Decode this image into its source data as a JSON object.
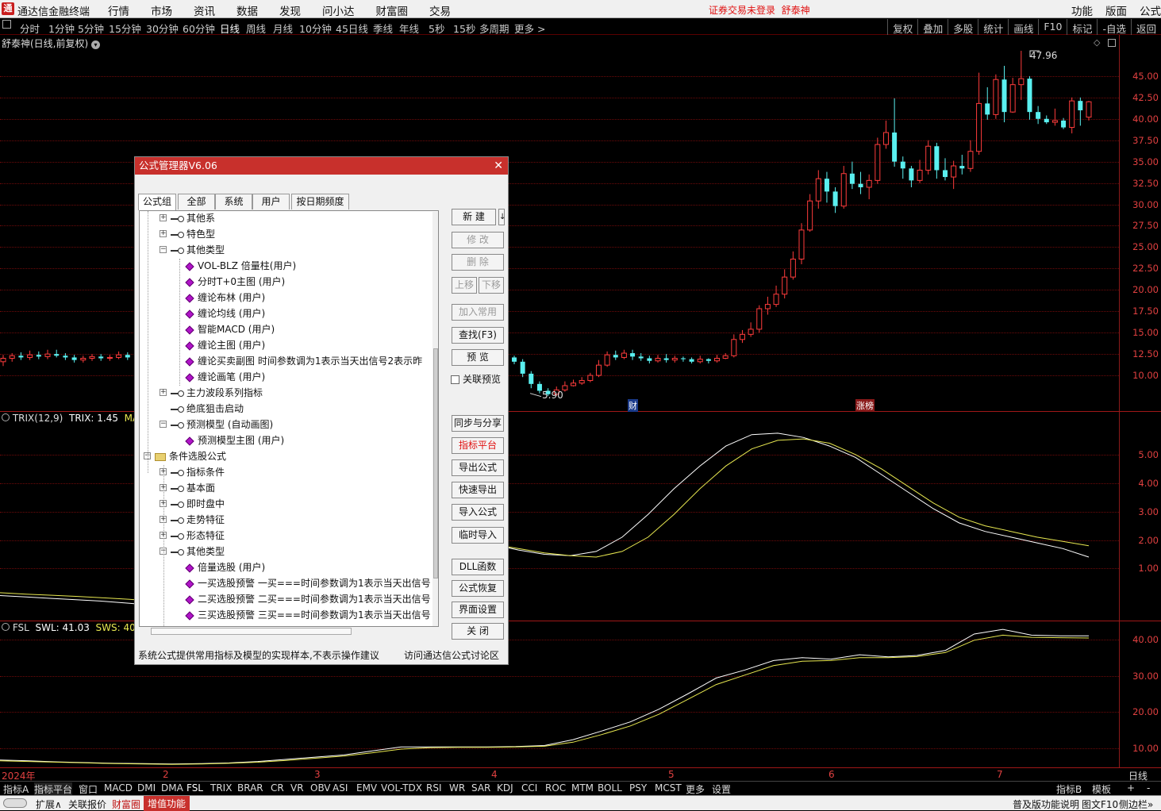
{
  "app": {
    "title": "通达信金融终端",
    "logo": "通"
  },
  "menu": [
    "行情",
    "市场",
    "资讯",
    "数据",
    "发现",
    "问小达",
    "财富圈",
    "交易"
  ],
  "login_status": "证券交易未登录",
  "stock_name": "舒泰神",
  "right_menu": [
    "功能",
    "版面",
    "公式"
  ],
  "periods": [
    "分时",
    "1分钟",
    "5分钟",
    "15分钟",
    "30分钟",
    "60分钟",
    "日线",
    "周线",
    "月线",
    "10分钟",
    "45日线",
    "季线",
    "年线",
    "5秒",
    "15秒",
    "多周期",
    "更多 >"
  ],
  "active_period": "日线",
  "right_tools": [
    "复权",
    "叠加",
    "多股",
    "统计",
    "画线",
    "F10",
    "标记",
    "-自选",
    "返回"
  ],
  "chart_title": "舒泰神(日线,前复权)",
  "price_axis": [
    "45.00",
    "42.50",
    "40.00",
    "37.50",
    "35.00",
    "32.50",
    "30.00",
    "27.50",
    "25.00",
    "22.50",
    "20.00",
    "17.50",
    "15.00",
    "12.50",
    "10.00"
  ],
  "high_label": "47.96",
  "low_label": "5.90",
  "event_tags": [
    "财",
    "涨榜"
  ],
  "trix": {
    "title": "TRIX(12,9)",
    "trix_label": "TRIX: 1.45",
    "matr_label": "MATR",
    "axis": [
      "5.00",
      "4.00",
      "3.00",
      "2.00",
      "1.00"
    ]
  },
  "fsl": {
    "title": "FSL",
    "swl_label": "SWL: 41.03",
    "sws_label": "SWS: 40.4",
    "axis": [
      "40.00",
      "30.00",
      "20.00",
      "10.00"
    ]
  },
  "x_axis": [
    "2024年",
    "2",
    "3",
    "4",
    "5",
    "6",
    "7"
  ],
  "x_axis_right": "日线",
  "indicator_tabs": [
    "指标A",
    "指标平台",
    "窗口",
    "MACD",
    "DMI",
    "DMA",
    "FSL",
    "TRIX",
    "BRAR",
    "CR",
    "VR",
    "OBV",
    "ASI",
    "EMV",
    "VOL-TDX",
    "RSI",
    "WR",
    "SAR",
    "KDJ",
    "CCI",
    "ROC",
    "MTM",
    "BOLL",
    "PSY",
    "MCST",
    "更多",
    "设置"
  ],
  "indicator_tabs_right": [
    "指标B",
    "模板",
    "+",
    "-"
  ],
  "statusbar": {
    "items": [
      "扩展∧",
      "关联报价",
      "财富圈",
      "增值功能"
    ],
    "right": [
      "普及版功能说明",
      "图文F10",
      "侧边栏»"
    ]
  },
  "dialog": {
    "title": "公式管理器V6.06",
    "tabs": [
      "公式组",
      "全部",
      "系统",
      "用户",
      "按日期频度"
    ],
    "tree": [
      {
        "level": 1,
        "type": "key",
        "pm": "+",
        "label": "其他系"
      },
      {
        "level": 1,
        "type": "key",
        "pm": "+",
        "label": "特色型"
      },
      {
        "level": 1,
        "type": "key",
        "pm": "-",
        "label": "其他类型"
      },
      {
        "level": 2,
        "type": "diam",
        "label": "VOL-BLZ  倍量柱(用户)"
      },
      {
        "level": 2,
        "type": "diam",
        "label": "分时T+0主图  (用户)"
      },
      {
        "level": 2,
        "type": "diam",
        "label": "缠论布林  (用户)"
      },
      {
        "level": 2,
        "type": "diam",
        "label": "缠论均线  (用户)"
      },
      {
        "level": 2,
        "type": "diam",
        "label": "智能MACD  (用户)"
      },
      {
        "level": 2,
        "type": "diam",
        "label": "缠论主图  (用户)"
      },
      {
        "level": 2,
        "type": "diam",
        "label": "缠论买卖副图  时间参数调为1表示当天出信号2表示昨"
      },
      {
        "level": 2,
        "type": "diam",
        "label": "缠论画笔  (用户)"
      },
      {
        "level": 1,
        "type": "key",
        "pm": "+",
        "label": "主力波段系列指标"
      },
      {
        "level": 1,
        "type": "key",
        "pm": "",
        "label": "绝底狙击启动"
      },
      {
        "level": 1,
        "type": "key",
        "pm": "-",
        "label": "预测模型  (自动画图)"
      },
      {
        "level": 2,
        "type": "diam",
        "label": "预测模型主图  (用户)"
      },
      {
        "level": 0,
        "type": "folder",
        "pm": "-",
        "label": "条件选股公式"
      },
      {
        "level": 1,
        "type": "key",
        "pm": "+",
        "label": "指标条件"
      },
      {
        "level": 1,
        "type": "key",
        "pm": "+",
        "label": "基本面"
      },
      {
        "level": 1,
        "type": "key",
        "pm": "+",
        "label": "即时盘中"
      },
      {
        "level": 1,
        "type": "key",
        "pm": "+",
        "label": "走势特征"
      },
      {
        "level": 1,
        "type": "key",
        "pm": "+",
        "label": "形态特征"
      },
      {
        "level": 1,
        "type": "key",
        "pm": "-",
        "label": "其他类型"
      },
      {
        "level": 2,
        "type": "diam",
        "label": "倍量选股  (用户)"
      },
      {
        "level": 2,
        "type": "diam",
        "label": "一买选股预警  一买===时间参数调为1表示当天出信号"
      },
      {
        "level": 2,
        "type": "diam",
        "label": "二买选股预警  二买===时间参数调为1表示当天出信号"
      },
      {
        "level": 2,
        "type": "diam",
        "label": "三买选股预警  三买===时间参数调为1表示当天出信号"
      }
    ],
    "buttons": [
      {
        "label": "新  建",
        "state": "normal"
      },
      {
        "label": "修  改",
        "state": "disabled"
      },
      {
        "label": "删  除",
        "state": "disabled"
      },
      {
        "label": "上移",
        "state": "disabled"
      },
      {
        "label": "下移",
        "state": "disabled"
      },
      {
        "label": "加入常用",
        "state": "disabled"
      },
      {
        "label": "查找(F3)",
        "state": "normal"
      },
      {
        "label": "预  览",
        "state": "normal"
      },
      {
        "label": "同步与分享",
        "state": "normal"
      },
      {
        "label": "指标平台",
        "state": "red"
      },
      {
        "label": "导出公式",
        "state": "normal"
      },
      {
        "label": "快速导出",
        "state": "normal"
      },
      {
        "label": "导入公式",
        "state": "normal"
      },
      {
        "label": "临时导入",
        "state": "normal"
      },
      {
        "label": "DLL函数",
        "state": "normal"
      },
      {
        "label": "公式恢复",
        "state": "normal"
      },
      {
        "label": "界面设置",
        "state": "normal"
      },
      {
        "label": "关  闭",
        "state": "normal"
      }
    ],
    "checkbox_label": "关联预览",
    "footer_left": "系统公式提供常用指标及模型的实现样本,不表示操作建议",
    "footer_right": "访问通达信公式讨论区"
  },
  "colors": {
    "up": "#ff3c3c",
    "down": "#5af0f0",
    "line1": "#ffffff",
    "line2": "#e8e850",
    "axis": "#e04040"
  },
  "chart_data": {
    "type": "candlestick",
    "price_range": [
      7.5,
      47.96
    ],
    "candles": [
      [
        11.6,
        12.0,
        12.4,
        11.1
      ],
      [
        12.0,
        12.3,
        12.6,
        11.6
      ],
      [
        12.3,
        12.1,
        12.7,
        11.8
      ],
      [
        12.1,
        12.4,
        12.9,
        11.8
      ],
      [
        12.4,
        12.2,
        12.8,
        11.9
      ],
      [
        12.2,
        12.5,
        13.0,
        11.9
      ],
      [
        12.5,
        12.3,
        13.0,
        12.1
      ],
      [
        12.3,
        12.1,
        12.6,
        11.8
      ],
      [
        12.1,
        11.8,
        12.4,
        11.5
      ],
      [
        11.8,
        12.0,
        12.3,
        11.5
      ],
      [
        12.0,
        12.2,
        12.5,
        11.7
      ],
      [
        12.2,
        12.0,
        12.5,
        11.7
      ],
      [
        12.0,
        12.1,
        12.4,
        11.7
      ],
      [
        12.1,
        12.4,
        12.8,
        11.9
      ],
      [
        12.4,
        12.1,
        12.7,
        11.8
      ],
      [
        12.1,
        11.6,
        12.3,
        11.3
      ],
      [
        11.6,
        10.2,
        11.9,
        9.8
      ],
      [
        10.2,
        9.0,
        10.5,
        8.5
      ],
      [
        9.0,
        8.2,
        9.3,
        7.9
      ],
      [
        8.2,
        7.8,
        8.5,
        7.6
      ],
      [
        7.8,
        8.3,
        8.7,
        7.6
      ],
      [
        8.3,
        8.8,
        9.3,
        8.1
      ],
      [
        8.8,
        9.1,
        9.5,
        8.7
      ],
      [
        9.1,
        9.4,
        9.8,
        8.9
      ],
      [
        9.4,
        10.0,
        10.3,
        9.2
      ],
      [
        10.0,
        11.2,
        11.8,
        9.8
      ],
      [
        11.2,
        12.4,
        12.8,
        11.0
      ],
      [
        12.4,
        12.1,
        12.9,
        11.8
      ],
      [
        12.1,
        12.6,
        13.0,
        11.9
      ],
      [
        12.6,
        12.2,
        13.0,
        11.8
      ],
      [
        12.2,
        12.0,
        12.6,
        11.7
      ],
      [
        12.0,
        11.7,
        12.3,
        11.4
      ],
      [
        11.7,
        12.0,
        12.4,
        11.5
      ],
      [
        12.0,
        11.8,
        12.5,
        11.5
      ],
      [
        11.8,
        12.0,
        12.3,
        11.5
      ],
      [
        12.0,
        11.9,
        12.2,
        11.6
      ],
      [
        11.9,
        11.6,
        12.1,
        11.4
      ],
      [
        11.6,
        11.9,
        12.3,
        11.4
      ],
      [
        11.9,
        11.7,
        12.0,
        11.4
      ],
      [
        11.7,
        12.0,
        12.4,
        11.5
      ],
      [
        12.0,
        12.3,
        12.6,
        11.9
      ],
      [
        12.3,
        14.2,
        14.8,
        12.1
      ],
      [
        14.2,
        14.8,
        15.3,
        13.8
      ],
      [
        14.8,
        15.4,
        16.2,
        14.5
      ],
      [
        15.4,
        17.8,
        18.2,
        15.0
      ],
      [
        17.8,
        18.3,
        19.2,
        17.1
      ],
      [
        18.3,
        19.5,
        20.5,
        18.0
      ],
      [
        19.5,
        21.5,
        22.4,
        19.0
      ],
      [
        21.5,
        23.6,
        24.5,
        21.2
      ],
      [
        23.6,
        27.0,
        27.8,
        23.0
      ],
      [
        27.0,
        30.4,
        31.2,
        26.8
      ],
      [
        30.4,
        33.0,
        34.0,
        29.5
      ],
      [
        33.0,
        31.5,
        33.8,
        30.2
      ],
      [
        31.5,
        29.8,
        32.0,
        29.0
      ],
      [
        29.8,
        33.6,
        34.5,
        29.5
      ],
      [
        33.6,
        32.4,
        35.0,
        31.8
      ],
      [
        32.4,
        32.0,
        33.8,
        31.2
      ],
      [
        32.0,
        32.8,
        33.5,
        30.6
      ],
      [
        32.8,
        37.0,
        37.8,
        32.4
      ],
      [
        37.0,
        38.4,
        39.8,
        36.5
      ],
      [
        38.4,
        35.0,
        42.4,
        34.4
      ],
      [
        35.0,
        34.2,
        35.6,
        33.0
      ],
      [
        34.2,
        32.8,
        34.5,
        32.0
      ],
      [
        32.8,
        34.0,
        35.2,
        32.5
      ],
      [
        34.0,
        36.8,
        37.5,
        33.5
      ],
      [
        36.8,
        34.0,
        37.2,
        33.0
      ],
      [
        34.0,
        33.2,
        35.4,
        32.8
      ],
      [
        33.2,
        34.5,
        35.1,
        31.8
      ],
      [
        34.5,
        34.2,
        35.8,
        33.5
      ],
      [
        34.2,
        36.2,
        37.5,
        33.8
      ],
      [
        36.2,
        41.8,
        45.4,
        35.8
      ],
      [
        41.8,
        40.5,
        43.7,
        39.9
      ],
      [
        40.5,
        44.6,
        45.2,
        40.0
      ],
      [
        44.6,
        40.8,
        46.2,
        39.6
      ],
      [
        40.8,
        44.0,
        44.8,
        40.7
      ],
      [
        44.0,
        44.7,
        47.96,
        42.2
      ],
      [
        44.7,
        40.8,
        45.0,
        39.9
      ],
      [
        40.8,
        40.0,
        41.5,
        39.4
      ],
      [
        40.0,
        39.6,
        40.4,
        39.4
      ],
      [
        39.6,
        39.8,
        41.2,
        39.2
      ],
      [
        39.8,
        39.0,
        40.1,
        38.8
      ],
      [
        39.0,
        42.1,
        42.5,
        38.3
      ],
      [
        42.1,
        41.0,
        42.5,
        39.2
      ],
      [
        40.2,
        42.0,
        42.1,
        39.8
      ]
    ],
    "trix_line": [
      0.05,
      0.0,
      -0.05,
      -0.1,
      -0.15,
      -0.22,
      -0.3,
      -0.38,
      -0.45,
      -0.5,
      -0.4,
      -0.2,
      0.1,
      0.5,
      1.0,
      1.5,
      1.9,
      2.05,
      2.0,
      1.85,
      1.65,
      1.5,
      1.45,
      1.6,
      2.1,
      2.9,
      3.8,
      4.6,
      5.3,
      5.7,
      5.75,
      5.6,
      5.3,
      4.9,
      4.3,
      3.7,
      3.1,
      2.6,
      2.3,
      2.1,
      1.9,
      1.7,
      1.4
    ],
    "matr_line": [
      0.15,
      0.1,
      0.06,
      0.02,
      -0.03,
      -0.08,
      -0.15,
      -0.22,
      -0.3,
      -0.38,
      -0.42,
      -0.38,
      -0.2,
      0.1,
      0.55,
      1.05,
      1.5,
      1.8,
      1.9,
      1.85,
      1.7,
      1.55,
      1.45,
      1.4,
      1.6,
      2.1,
      2.9,
      3.8,
      4.6,
      5.2,
      5.5,
      5.55,
      5.4,
      5.0,
      4.5,
      3.9,
      3.3,
      2.8,
      2.5,
      2.3,
      2.1,
      1.95,
      1.8
    ],
    "trix_range": [
      -0.8,
      6.5
    ],
    "swl_line": [
      6.8,
      6.6,
      6.3,
      6.1,
      5.9,
      5.8,
      5.7,
      5.8,
      6.0,
      6.4,
      7.0,
      7.6,
      8.2,
      9.3,
      10.4,
      10.4,
      10.4,
      10.4,
      10.5,
      10.8,
      12.4,
      14.8,
      17.3,
      20.8,
      25.0,
      29.4,
      31.6,
      34.2,
      35.0,
      34.6,
      35.8,
      35.2,
      35.6,
      37.0,
      41.5,
      42.8,
      41.2,
      41.0,
      41.03
    ],
    "sws_line": [
      6.6,
      6.4,
      6.2,
      6.0,
      5.8,
      5.7,
      5.6,
      5.7,
      5.9,
      6.2,
      6.7,
      7.3,
      7.9,
      8.8,
      9.8,
      10.2,
      10.3,
      10.3,
      10.4,
      10.6,
      11.7,
      13.8,
      16.2,
      19.4,
      23.5,
      27.6,
      30.2,
      32.8,
      34.0,
      34.2,
      35.0,
      35.0,
      35.3,
      36.4,
      39.8,
      41.2,
      40.6,
      40.5,
      40.4
    ],
    "fsl_range": [
      5,
      45
    ]
  }
}
